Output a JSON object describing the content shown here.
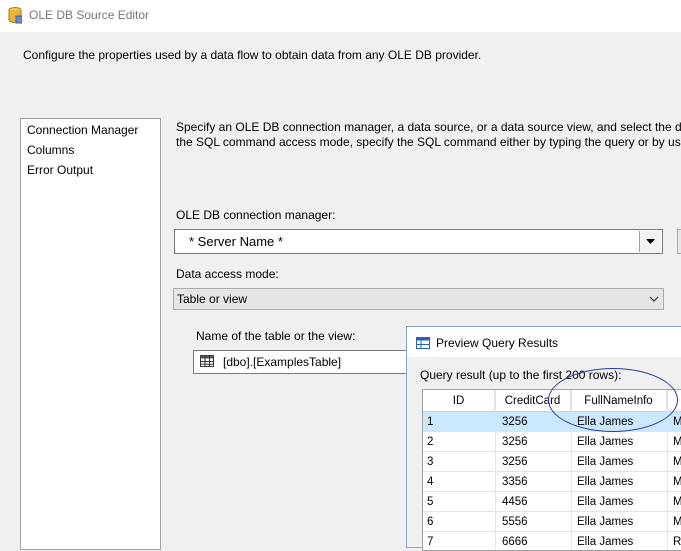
{
  "window": {
    "title": "OLE DB Source Editor"
  },
  "description": "Configure the properties used by a data flow to obtain data from any OLE DB provider.",
  "nav": {
    "items": [
      {
        "label": "Connection Manager"
      },
      {
        "label": "Columns"
      },
      {
        "label": "Error Output"
      }
    ],
    "selected_index": 0
  },
  "instructions": [
    "Specify an OLE DB connection manager, a data source, or a data source view, and select the data",
    "the SQL command access mode, specify the SQL command either by typing the query or by usin"
  ],
  "connection": {
    "label": "OLE DB connection manager:",
    "value": "* Server Name *"
  },
  "access_mode": {
    "label": "Data access mode:",
    "value": "Table or view"
  },
  "table": {
    "label": "Name of the table or the view:",
    "value": "[dbo].[ExamplesTable]"
  },
  "preview": {
    "title": "Preview Query Results",
    "result_label": "Query result (up to the first 200 rows):",
    "columns": [
      "ID",
      "CreditCard",
      "FullNameInfo",
      ""
    ],
    "rows": [
      [
        "1",
        "3256",
        "Ella James",
        "M"
      ],
      [
        "2",
        "3256",
        "Ella James",
        "M"
      ],
      [
        "3",
        "3256",
        "Ella James",
        "M"
      ],
      [
        "4",
        "3356",
        "Ella James",
        "M"
      ],
      [
        "5",
        "4456",
        "Ella James",
        "M"
      ],
      [
        "6",
        "5556",
        "Ella James",
        "M"
      ],
      [
        "7",
        "6666",
        "Ella James",
        "R"
      ]
    ],
    "selected_row": 0
  },
  "colors": {
    "selection": "#cce8ff",
    "annotation": "#2b3ea0"
  }
}
